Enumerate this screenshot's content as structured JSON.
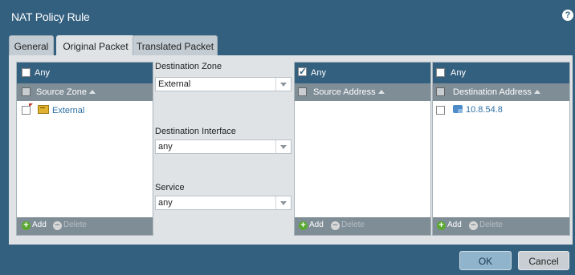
{
  "dialog": {
    "title": "NAT Policy Rule",
    "help_icon": "help-icon",
    "ok_label": "OK",
    "cancel_label": "Cancel"
  },
  "tabs": [
    {
      "label": "General",
      "active": false
    },
    {
      "label": "Original Packet",
      "active": true
    },
    {
      "label": "Translated Packet",
      "active": false
    }
  ],
  "source_zone": {
    "any_label": "Any",
    "any_checked": false,
    "column_header": "Source Zone",
    "rows": [
      {
        "label": "External",
        "icon": "zone-icon"
      }
    ],
    "add_label": "Add",
    "delete_label": "Delete"
  },
  "destination_zone": {
    "label": "Destination Zone",
    "value": "External"
  },
  "destination_interface": {
    "label": "Destination Interface",
    "value": "any"
  },
  "service": {
    "label": "Service",
    "value": "any"
  },
  "source_address": {
    "any_label": "Any",
    "any_checked": true,
    "column_header": "Source Address",
    "rows": [],
    "add_label": "Add",
    "delete_label": "Delete"
  },
  "destination_address": {
    "any_label": "Any",
    "any_checked": false,
    "column_header": "Destination Address",
    "rows": [
      {
        "label": "10.8.54.8",
        "icon": "address-icon"
      }
    ],
    "add_label": "Add",
    "delete_label": "Delete"
  },
  "colors": {
    "title_bar": "#34607f",
    "grid_header": "#7f8d96",
    "link": "#2d6fa5",
    "add": "#5aa830"
  }
}
